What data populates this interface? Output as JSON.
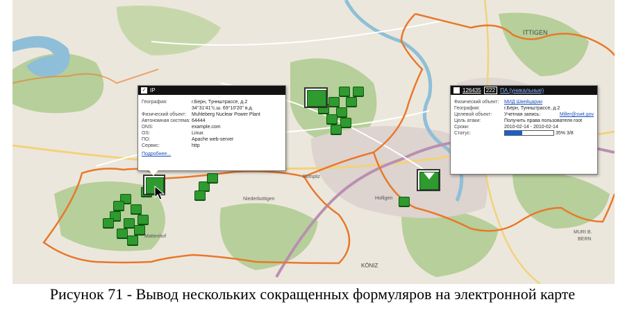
{
  "map": {
    "labels": {
      "ittigen": "ITTIGEN",
      "koniz": "KÖNIZ",
      "muri": "MURI B.",
      "bern": "BERN",
      "niederbottigen": "Niederbottigen",
      "bumpliz": "Bümpliz",
      "holligen": "Holligen",
      "mattenhof": "Mattenhof"
    },
    "colors": {
      "boundary": "#e8782a",
      "river": "#8fbfd8",
      "forest": "#b7cf9a",
      "marker": "#2f9a2f",
      "highway": "#b98fb1"
    }
  },
  "popup_left": {
    "header": "IP",
    "rows": [
      {
        "k": "География:",
        "v": "г.Берн, Туннштрассе, д.2"
      },
      {
        "k": "",
        "v": "34°31'41\"с.ш.   69°10'20\" в.д."
      },
      {
        "k": "Физический объект:",
        "v": "Muhleberg Nuclear Power Plant"
      },
      {
        "k": "Автономная система:",
        "v": "64444"
      },
      {
        "k": "DNS:",
        "v": "example.com"
      },
      {
        "k": "OS:",
        "v": "Linux"
      },
      {
        "k": "ПО:",
        "v": "Apache web-server"
      },
      {
        "k": "Сервис:",
        "v": "http"
      }
    ],
    "more_link": "Подробнее..."
  },
  "popup_right": {
    "header_id": "126435",
    "header_num": "222",
    "header_link": "ПА (уникальные)",
    "rows": [
      {
        "k": "Физический объект:",
        "v": "МИД Швейцарии",
        "link": true
      },
      {
        "k": "География:",
        "v": "г.Берн, Туннштрассе, д.2"
      },
      {
        "k": "Целевой объект:",
        "v": "Учетная запись: ",
        "v2": "Miller@swit.gov",
        "link2": true
      },
      {
        "k": "Цель атаки:",
        "v": "Получить права пользователя root"
      },
      {
        "k": "Сроки:",
        "v": "2010-02-14 - 2010-02-14"
      }
    ],
    "status_label": "Статус:",
    "status_percent": "35%",
    "status_count": "3/8",
    "status_fraction": 0.35
  },
  "caption": "Рисунок 71 - Вывод нескольких сокращенных формуляров на электронной карте"
}
